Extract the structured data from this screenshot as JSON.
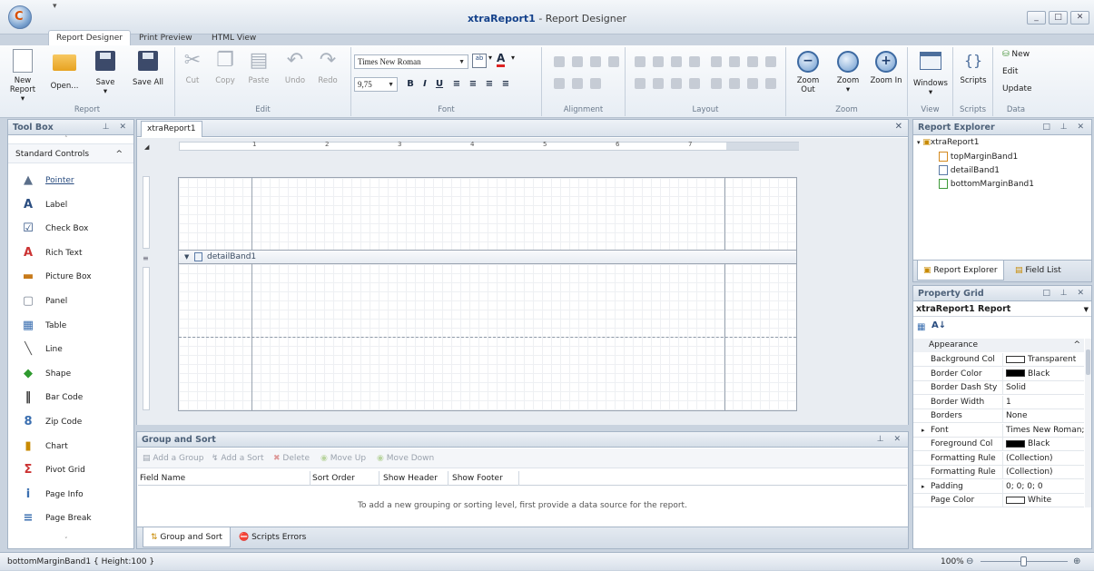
{
  "window": {
    "title_bold": "xtraReport1",
    "title_rest": " - Report Designer"
  },
  "ribbon": {
    "tabs": [
      "Report Designer",
      "Print Preview",
      "HTML View"
    ],
    "groups": {
      "report": "Report",
      "edit": "Edit",
      "font": "Font",
      "alignment": "Alignment",
      "layout": "Layout",
      "zoom": "Zoom",
      "view": "View",
      "scripts": "Scripts",
      "data": "Data"
    },
    "report_buttons": [
      "New Report",
      "Open...",
      "Save",
      "Save All"
    ],
    "edit_buttons": [
      "Cut",
      "Copy",
      "Paste",
      "Undo",
      "Redo"
    ],
    "font_name": "Times New Roman",
    "font_size": "9,75",
    "zoom_buttons": [
      "Zoom Out",
      "Zoom",
      "Zoom In"
    ],
    "windows": "Windows",
    "scripts": "Scripts",
    "data_buttons": [
      "New",
      "Edit",
      "Update"
    ]
  },
  "toolbox": {
    "title": "Tool Box",
    "category": "Standard Controls",
    "items": [
      "Pointer",
      "Label",
      "Check Box",
      "Rich Text",
      "Picture Box",
      "Panel",
      "Table",
      "Line",
      "Shape",
      "Bar Code",
      "Zip Code",
      "Chart",
      "Pivot Grid",
      "Page Info",
      "Page Break"
    ]
  },
  "document": {
    "tab": "xtraReport1",
    "band": "detailBand1",
    "ruler_labels": [
      "1",
      "2",
      "3",
      "4",
      "5",
      "6",
      "7"
    ]
  },
  "group_sort": {
    "title": "Group and Sort",
    "toolbar": [
      "Add a Group",
      "Add a Sort",
      "Delete",
      "Move Up",
      "Move Down"
    ],
    "columns": [
      "Field Name",
      "Sort Order",
      "Show Header",
      "Show Footer"
    ],
    "empty": "To add a new grouping or sorting level, first provide a data source for the report.",
    "tabs": [
      "Group and Sort",
      "Scripts Errors"
    ]
  },
  "explorer": {
    "title": "Report Explorer",
    "root": "xtraReport1",
    "children": [
      "topMarginBand1",
      "detailBand1",
      "bottomMarginBand1"
    ],
    "tabs": [
      "Report Explorer",
      "Field List"
    ]
  },
  "property_grid": {
    "title": "Property Grid",
    "object": "xtraReport1 Report",
    "category": "Appearance",
    "rows": [
      {
        "key": "Background Col",
        "value": "Transparent",
        "swatch": "#ffffff"
      },
      {
        "key": "Border Color",
        "value": "Black",
        "swatch": "#000000"
      },
      {
        "key": "Border Dash Sty",
        "value": "Solid"
      },
      {
        "key": "Border Width",
        "value": "1"
      },
      {
        "key": "Borders",
        "value": "None"
      },
      {
        "key": "Font",
        "value": "Times New Roman; ...",
        "expand": true
      },
      {
        "key": "Foreground Col",
        "value": "Black",
        "swatch": "#000000"
      },
      {
        "key": "Formatting Rule",
        "value": "(Collection)"
      },
      {
        "key": "Formatting Rule",
        "value": "(Collection)"
      },
      {
        "key": "Padding",
        "value": "0; 0; 0; 0",
        "expand": true
      },
      {
        "key": "Page Color",
        "value": "White",
        "swatch": "#ffffff"
      }
    ]
  },
  "status": {
    "text": "bottomMarginBand1 { Height:100 }",
    "zoom": "100%"
  }
}
